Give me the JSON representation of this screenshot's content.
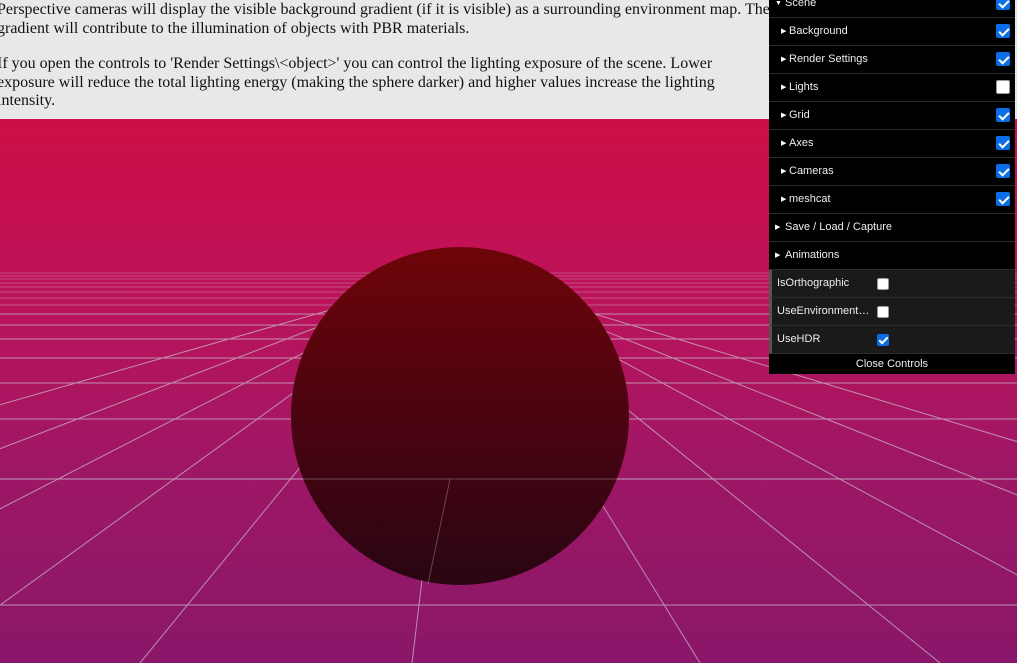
{
  "intro": {
    "paragraph1": "Perspective cameras will display the visible background gradient (if it is visible) as a surrounding environment map. The gradient will contribute to the illumination of objects with PBR materials.",
    "paragraph2": "If you open the controls to 'Render Settings\\<object>' you can control the lighting exposure of the scene. Lower exposure will reduce the total lighting energy (making the sphere darker) and higher values increase the lighting intensity."
  },
  "gui": {
    "scene": {
      "label": "Scene",
      "checked": true
    },
    "scene_items": [
      {
        "label": "Background",
        "checked": true
      },
      {
        "label": "Render Settings",
        "checked": true
      },
      {
        "label": "Lights",
        "checked": false
      },
      {
        "label": "Grid",
        "checked": true
      },
      {
        "label": "Axes",
        "checked": true
      },
      {
        "label": "Cameras",
        "checked": true
      },
      {
        "label": "meshcat",
        "checked": true
      }
    ],
    "folders": [
      {
        "label": "Save / Load / Capture"
      },
      {
        "label": "Animations"
      }
    ],
    "properties": [
      {
        "label": "IsOrthographic",
        "checked": false
      },
      {
        "label": "UseEnvironment…",
        "checked": false
      },
      {
        "label": "UseHDR",
        "checked": true
      }
    ],
    "close_label": "Close Controls"
  },
  "colors": {
    "background_top": "#cc1046",
    "background_bottom": "#8a176a",
    "sphere_top": "#6a0508",
    "sphere_bottom": "#2e0410",
    "gui_bg": "#000000",
    "checkbox_on": "#0b6ee8"
  }
}
